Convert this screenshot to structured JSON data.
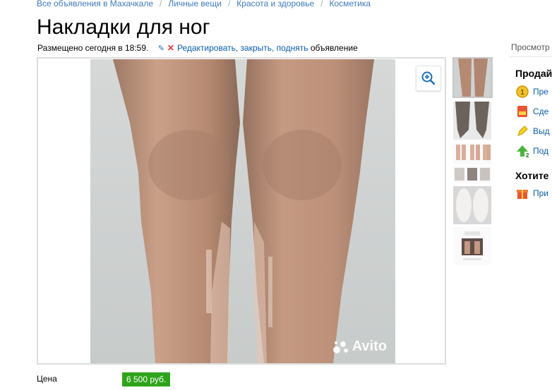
{
  "breadcrumb": [
    {
      "label": "Все объявления в Махачкале"
    },
    {
      "label": "Личные вещи"
    },
    {
      "label": "Красота и здоровье"
    },
    {
      "label": "Косметика"
    }
  ],
  "title": "Накладки для ног",
  "meta": {
    "posted": "Размещено сегодня в 18:59.",
    "edit_link": "Редактировать, закрыть, поднять",
    "edit_suffix": "объявление"
  },
  "photo": {
    "watermark": "Avito"
  },
  "icons": {
    "zoom": "zoom-in-icon",
    "edit": "pencil-icon",
    "close": "close-icon"
  },
  "thumbnails_count": 6,
  "sidebar": {
    "views": "Просмотр",
    "sell_heading": "Продай",
    "sell_items": [
      {
        "label": "Пре",
        "icon": "coin-1-icon"
      },
      {
        "label": "Сде",
        "icon": "vip-icon"
      },
      {
        "label": "Выд",
        "icon": "highlighter-icon"
      },
      {
        "label": "Под",
        "icon": "arrow-up-2-icon"
      }
    ],
    "want_heading": "Хотите",
    "want_items": [
      {
        "label": "При",
        "icon": "gift-box-icon"
      }
    ]
  },
  "price": {
    "label": "Цена",
    "value": "6 500 руб."
  },
  "colors": {
    "link": "#0a5da8",
    "price_bg": "#2ea41a",
    "close": "#e0302c"
  }
}
